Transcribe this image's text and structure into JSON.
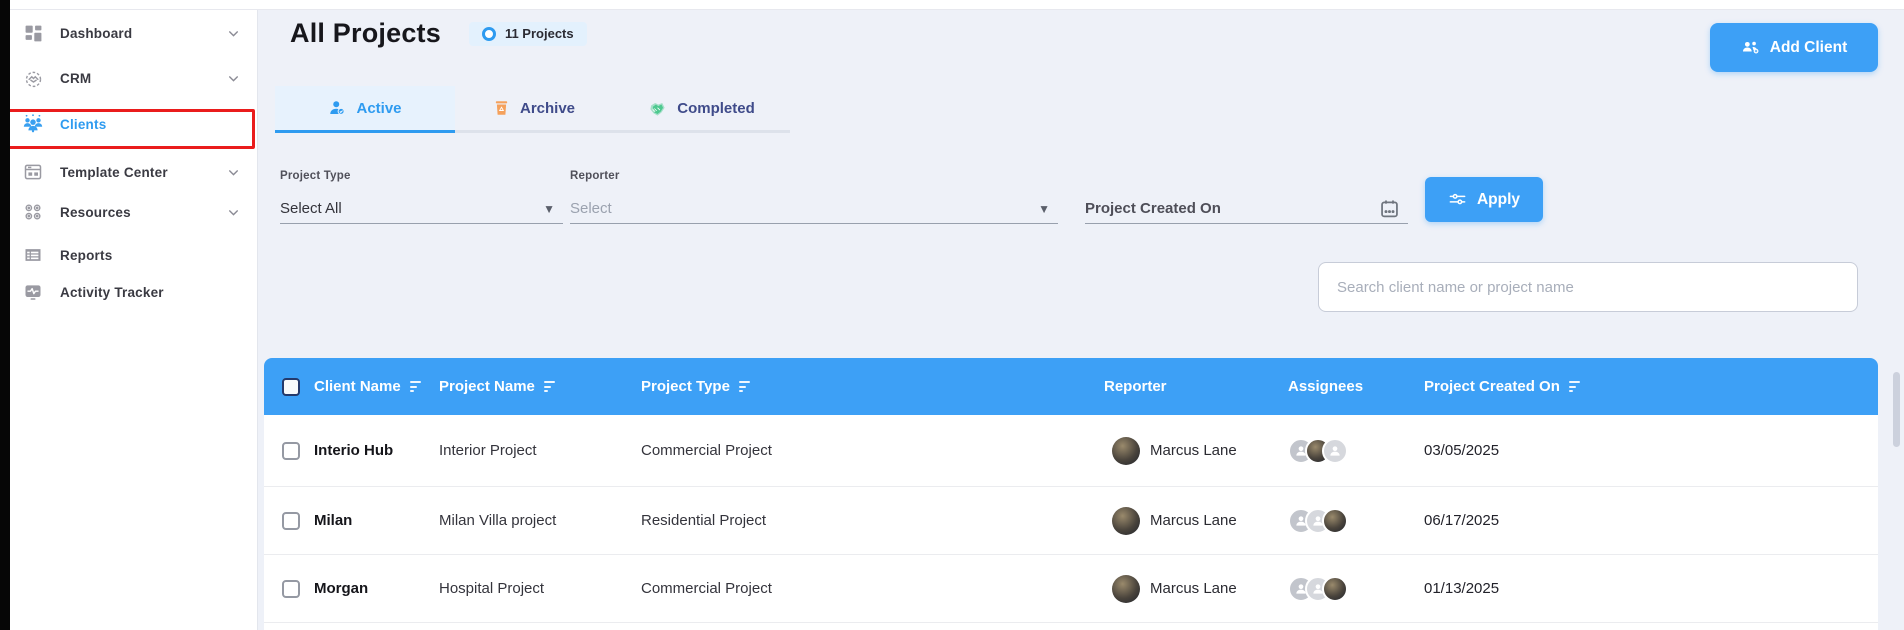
{
  "colors": {
    "primary_blue": "#3da0f6",
    "active_blue": "#2e9bf0",
    "tab_text": "#3f4b8a",
    "page_bg": "#eef1f8",
    "highlight_red": "#ea1c1c",
    "archive_orange": "#f5a15c",
    "completed_green": "#4ec990",
    "table_header_bg": "#3da0f6"
  },
  "sidebar": {
    "items": [
      {
        "label": "Dashboard",
        "icon": "dashboard-icon",
        "chevron": true,
        "active": false
      },
      {
        "label": "CRM",
        "icon": "crm-icon",
        "chevron": true,
        "active": false
      },
      {
        "label": "Clients",
        "icon": "clients-icon",
        "chevron": false,
        "active": true
      },
      {
        "label": "Template Center",
        "icon": "template-center-icon",
        "chevron": true,
        "active": false
      },
      {
        "label": "Resources",
        "icon": "resources-icon",
        "chevron": true,
        "active": false
      },
      {
        "label": "Reports",
        "icon": "reports-icon",
        "chevron": false,
        "active": false
      },
      {
        "label": "Activity Tracker",
        "icon": "activity-tracker-icon",
        "chevron": false,
        "active": false
      }
    ]
  },
  "header": {
    "title": "All Projects",
    "projects_badge": "11 Projects",
    "add_client_label": "Add Client"
  },
  "tabs": [
    {
      "label": "Active",
      "icon": "person-check-icon",
      "active": true
    },
    {
      "label": "Archive",
      "icon": "trash-recycle-icon",
      "active": false
    },
    {
      "label": "Completed",
      "icon": "handshake-icon",
      "active": false
    }
  ],
  "filters": {
    "project_type_label": "Project Type",
    "project_type_value": "Select All",
    "reporter_label": "Reporter",
    "reporter_placeholder": "Select",
    "created_on_placeholder": "Project Created On",
    "apply_label": "Apply"
  },
  "search": {
    "placeholder": "Search client name or project name"
  },
  "table": {
    "columns": [
      "Client Name",
      "Project Name",
      "Project Type",
      "Reporter",
      "Assignees",
      "Project Created On"
    ],
    "sorted_columns": [
      "Client Name",
      "Project Name",
      "Project Type",
      "Project Created On"
    ],
    "rows": [
      {
        "client": "Interio Hub",
        "project": "Interior Project",
        "type": "Commercial Project",
        "reporter": "Marcus Lane",
        "assignees_count": 3,
        "created": "03/05/2025"
      },
      {
        "client": "Milan",
        "project": "Milan Villa project",
        "type": "Residential Project",
        "reporter": "Marcus Lane",
        "assignees_count": 3,
        "created": "06/17/2025"
      },
      {
        "client": "Morgan",
        "project": "Hospital Project",
        "type": "Commercial Project",
        "reporter": "Marcus Lane",
        "assignees_count": 3,
        "created": "01/13/2025"
      }
    ]
  }
}
